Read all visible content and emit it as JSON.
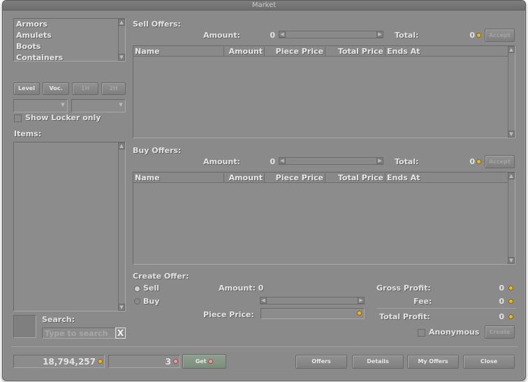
{
  "window": {
    "title": "Market"
  },
  "categories": [
    "Armors",
    "Amulets",
    "Boots",
    "Containers"
  ],
  "filters": {
    "level": "Level",
    "vocation": "Voc.",
    "one_hand": "1H",
    "two_hand": "2H",
    "show_locker_only": "Show Locker only"
  },
  "items_label": "Items:",
  "search": {
    "label": "Search:",
    "placeholder": "Type to search",
    "clear": "X"
  },
  "sell_offers": {
    "title": "Sell Offers:",
    "amount_label": "Amount:",
    "amount_value": "0",
    "total_label": "Total:",
    "total_value": "0",
    "accept": "Accept",
    "columns": [
      "Name",
      "Amount",
      "Piece Price",
      "Total Price",
      "Ends At"
    ]
  },
  "buy_offers": {
    "title": "Buy Offers:",
    "amount_label": "Amount:",
    "amount_value": "0",
    "total_label": "Total:",
    "total_value": "0",
    "accept": "Accept",
    "columns": [
      "Name",
      "Amount",
      "Piece Price",
      "Total Price",
      "Ends At"
    ]
  },
  "create_offer": {
    "title": "Create Offer:",
    "sell": "Sell",
    "buy": "Buy",
    "amount_label": "Amount: 0",
    "piece_price_label": "Piece Price:",
    "gross_profit_label": "Gross Profit:",
    "gross_profit_value": "0",
    "fee_label": "Fee:",
    "fee_value": "0",
    "total_profit_label": "Total Profit:",
    "total_profit_value": "0",
    "anonymous": "Anonymous",
    "create": "Create"
  },
  "footer": {
    "balance": "18,794,257",
    "coins": "3",
    "get": "Get",
    "offers": "Offers",
    "details": "Details",
    "my_offers": "My Offers",
    "close": "Close"
  }
}
